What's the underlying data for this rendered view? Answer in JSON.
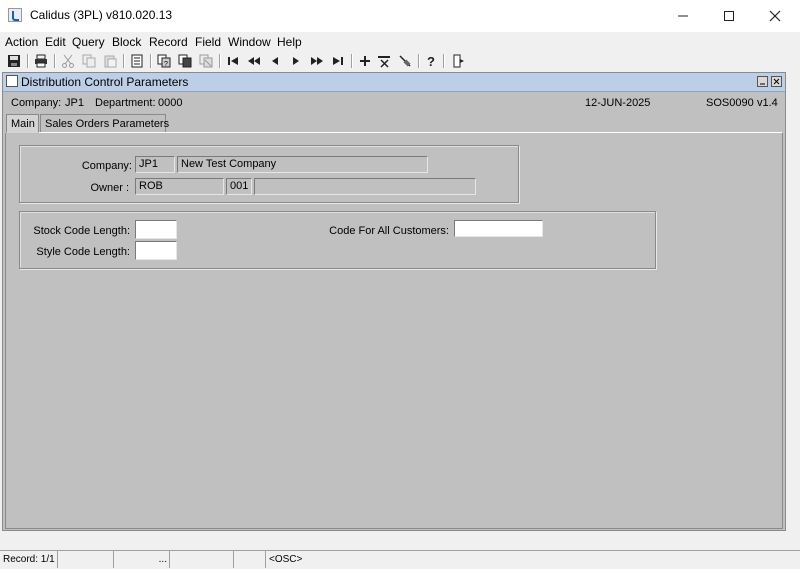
{
  "window": {
    "title": "Calidus (3PL) v810.020.13",
    "minimize": "—",
    "maximize": "☐",
    "close": "✕"
  },
  "menu": [
    {
      "label": "Action"
    },
    {
      "label": "Edit"
    },
    {
      "label": "Query"
    },
    {
      "label": "Block"
    },
    {
      "label": "Record"
    },
    {
      "label": "Field"
    },
    {
      "label": "Window"
    },
    {
      "label": "Help"
    }
  ],
  "toolbar_icons": [
    "save-icon",
    "print-icon",
    "cut-icon",
    "copy-icon",
    "paste-icon",
    "list-icon",
    "enter-query-icon",
    "execute-query-icon",
    "cancel-query-icon",
    "first-record-icon",
    "previous-block-icon",
    "previous-record-icon",
    "next-record-icon",
    "next-block-icon",
    "last-record-icon",
    "insert-record-icon",
    "delete-record-icon",
    "clear-record-icon",
    "help-icon",
    "exit-icon"
  ],
  "form": {
    "title": "Distribution Control Parameters",
    "company_label": "Company:",
    "company_value": "JP1",
    "department_label": "Department:",
    "department_value": "0000",
    "date": "12-JUN-2025",
    "form_id": "SOS0090",
    "version": "v1.4",
    "tabs": [
      {
        "label": "Main"
      },
      {
        "label": "Sales Orders Parameters"
      }
    ]
  },
  "main": {
    "company_label": "Company:",
    "company_code": "JP1",
    "company_name": "New Test Company",
    "owner_label": "Owner :",
    "owner_value": "ROB",
    "owner_code": "001",
    "owner_desc": "",
    "stock_code_length_label": "Stock Code Length:",
    "stock_code_length_value": "",
    "style_code_length_label": "Style Code Length:",
    "style_code_length_value": "",
    "code_for_all_customers_label": "Code For All Customers:",
    "code_for_all_customers_value": ""
  },
  "status": {
    "record": "Record: 1/1",
    "cell2": "",
    "cell3": "...",
    "cell4": "",
    "mode": "<OSC>"
  }
}
